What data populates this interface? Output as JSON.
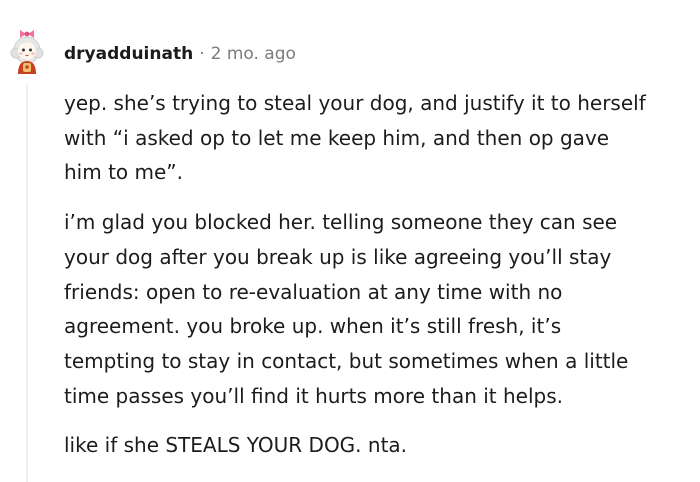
{
  "comment": {
    "author": "dryadduinath",
    "separator": "·",
    "age": "2 mo. ago",
    "avatar_icon": "user-avatar-icon",
    "paragraphs": [
      "yep. she’s trying to steal your dog, and justify it to herself\nwith “i asked op to let me keep him, and then op gave\nhim to me”.",
      "i’m glad you blocked her. telling someone they can see\nyour dog after you break up is like agreeing you’ll stay\nfriends: open to re-evaluation at any time with no\nagreement. you broke up. when it’s still fresh, it’s\ntempting to stay in contact, but sometimes when a little\ntime passes you’ll find it hurts more than it helps.",
      "like if she STEALS YOUR DOG. nta."
    ]
  }
}
